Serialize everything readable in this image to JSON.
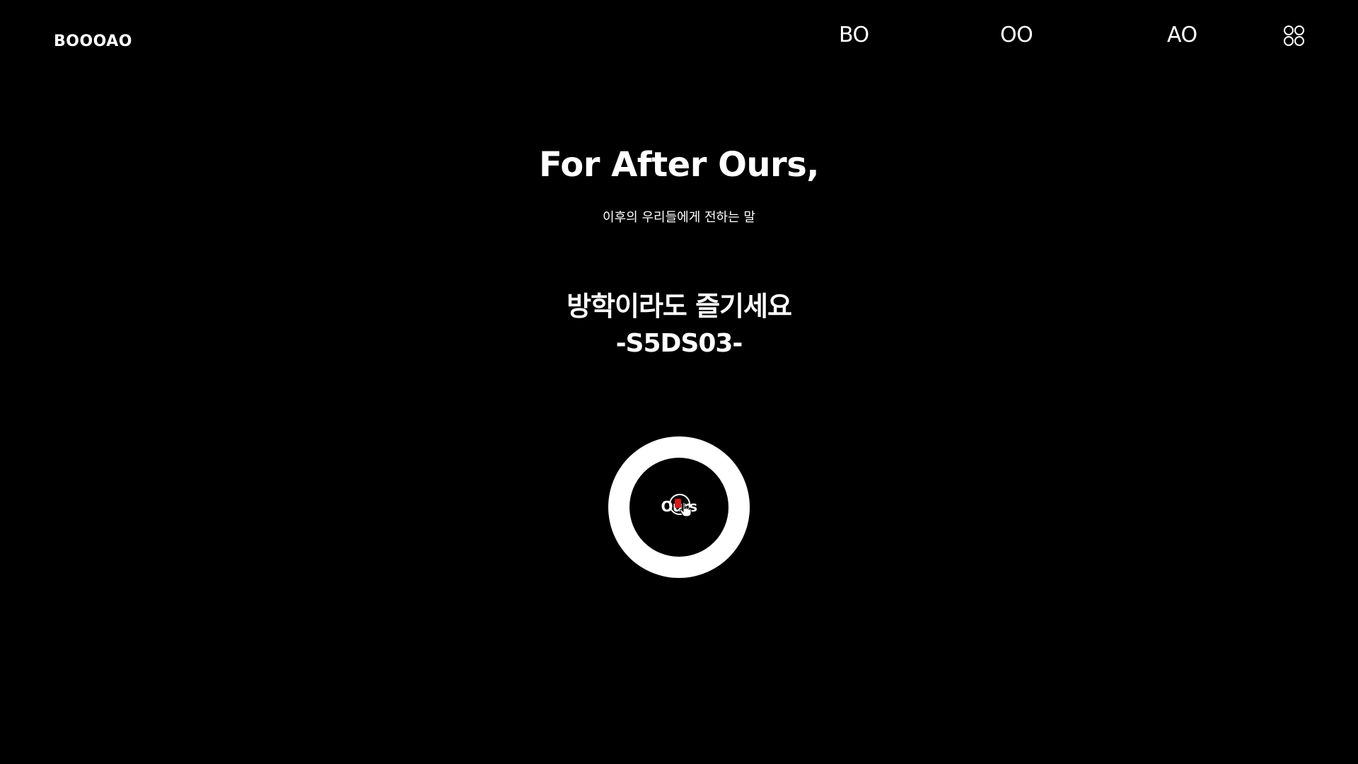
{
  "header": {
    "logo": "BOOOAO",
    "nav": [
      {
        "label": "BO"
      },
      {
        "label": "OO"
      },
      {
        "label": "AO"
      }
    ],
    "menu_icon": "grid-dots-icon"
  },
  "hero": {
    "title": "For After Ours,",
    "subtitle": "이후의 우리들에게 전하는 말",
    "message": "방학이라도 즐기세요",
    "signature": "-S5DS03-"
  },
  "action_button": {
    "label": "Ours"
  },
  "colors": {
    "background": "#000000",
    "foreground": "#ffffff",
    "accent": "#d21a1a"
  }
}
